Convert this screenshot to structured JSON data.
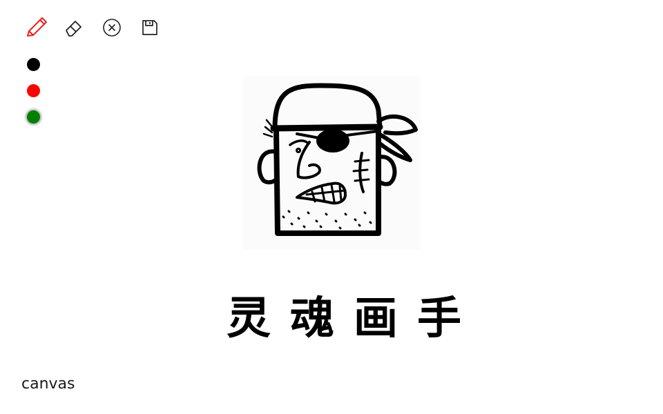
{
  "toolbar": {
    "tools": [
      {
        "name": "pencil",
        "icon": "pencil-icon",
        "active": true,
        "color": "#e8231f"
      },
      {
        "name": "eraser",
        "icon": "eraser-icon",
        "active": false
      },
      {
        "name": "clear",
        "icon": "close-circle-icon",
        "active": false
      },
      {
        "name": "save",
        "icon": "save-icon",
        "active": false
      }
    ]
  },
  "palette": {
    "colors": [
      "#000000",
      "#ff0000",
      "#008000"
    ],
    "selected": "#008000"
  },
  "illustration": {
    "subject": "pirate-head-drawing"
  },
  "app_title": "灵魂画手",
  "canvas_label": "canvas"
}
